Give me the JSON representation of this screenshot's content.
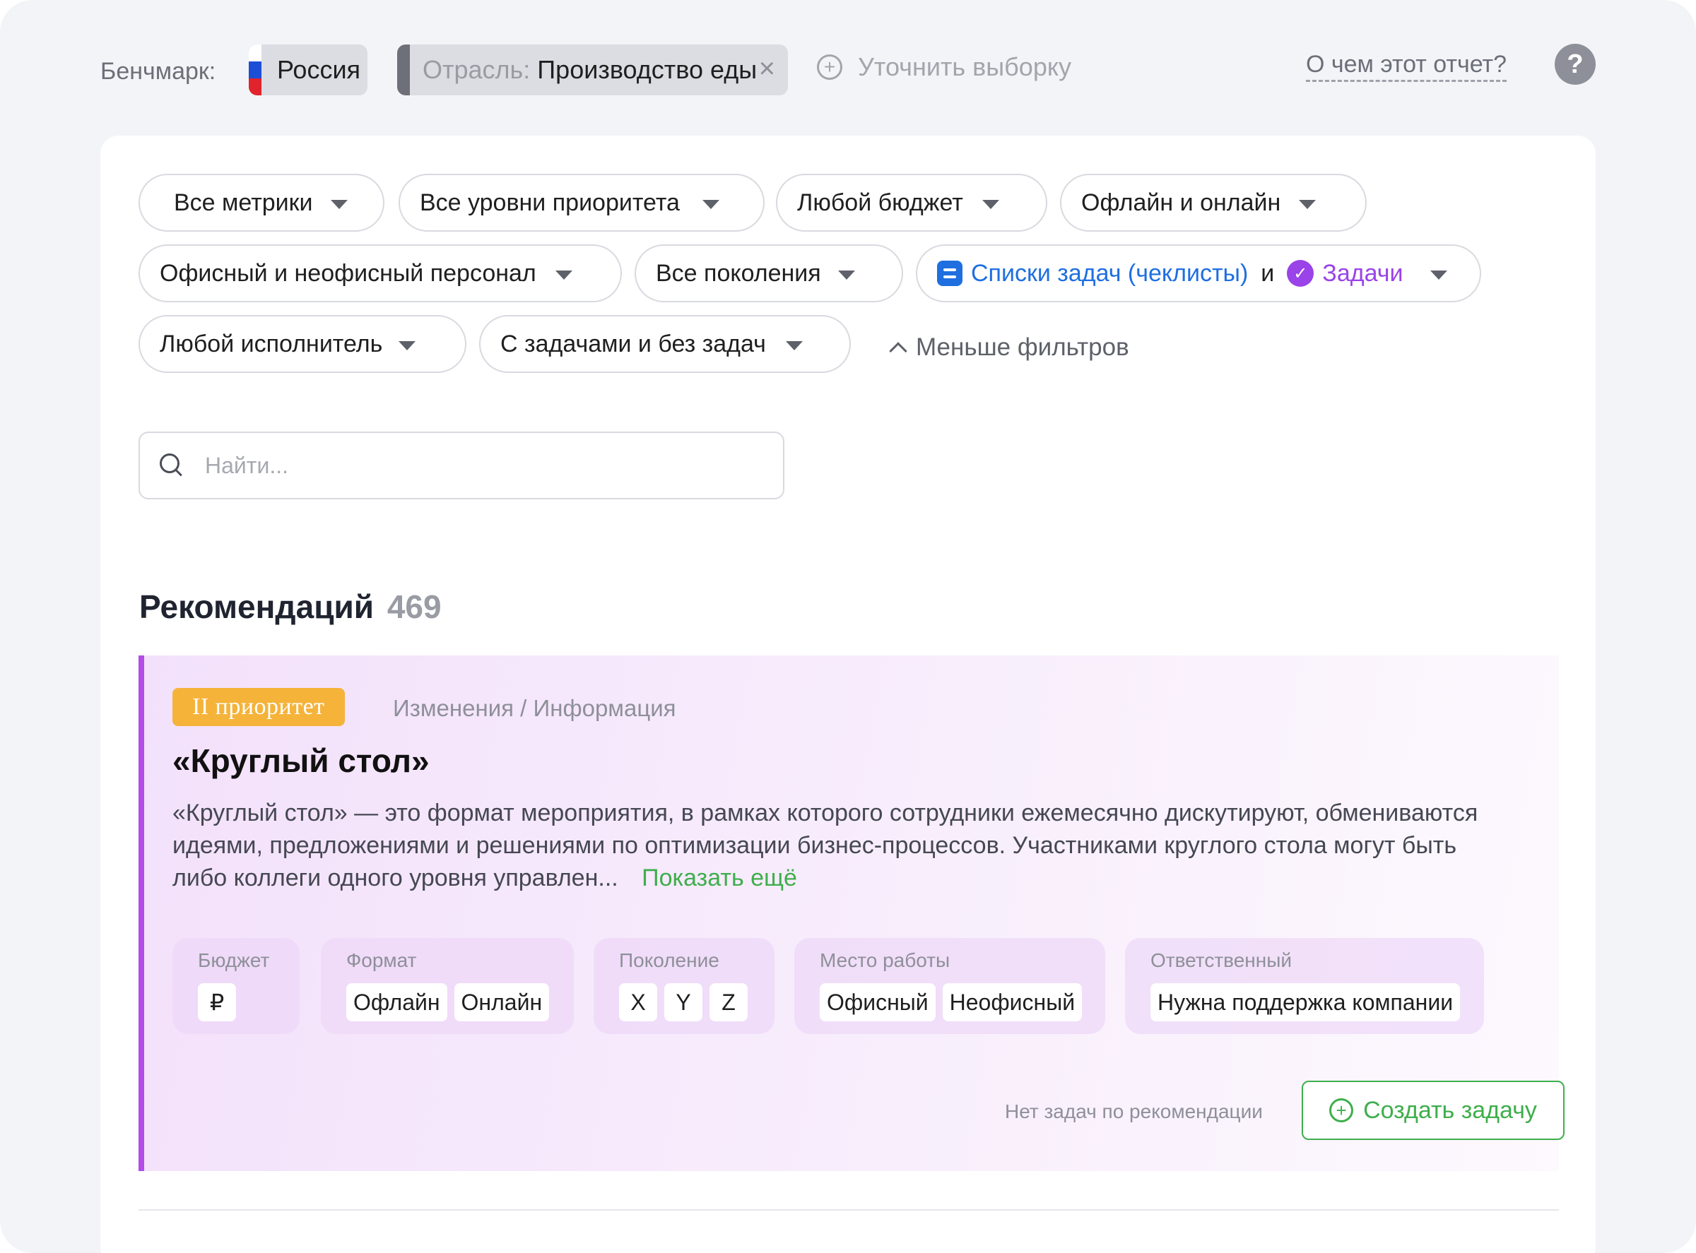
{
  "colors": {
    "background": "#f3f4f7",
    "accent_green": "#3fae4c",
    "accent_blue": "#1f6fe0",
    "accent_purple": "#9a43e8",
    "priority_badge": "#f5b33a",
    "card_border": "#b34ce8"
  },
  "header": {
    "benchmark_label": "Бенчмарк:",
    "country_chip": "Россия",
    "country_flag": [
      "#ffffff",
      "#1c4fd6",
      "#e0232c"
    ],
    "industry_prefix": "Отрасль:",
    "industry_value": "Производство еды",
    "industry_close_icon": "×",
    "refine_icon": "+",
    "refine_label": "Уточнить выборку",
    "about_link": "О чем этот отчет?",
    "help_icon": "?"
  },
  "filters": {
    "metrics": "Все метрики",
    "priority": "Все уровни приоритета",
    "budget": "Любой бюджет",
    "format": "Офлайн и онлайн",
    "staff": "Офисный и неофисный персонал",
    "generations": "Все поколения",
    "checklists": "Списки задач (чеклисты)",
    "and_word": "и",
    "tasks": "Задачи",
    "executor": "Любой исполнитель",
    "with_tasks": "С задачами и без задач",
    "fewer_filters": "Меньше фильтров"
  },
  "search": {
    "placeholder": "Найти..."
  },
  "recommendations": {
    "title": "Рекомендаций",
    "count": "469"
  },
  "card": {
    "priority": "II приоритет",
    "category": "Изменения / Информация",
    "title": "«Круглый стол»",
    "description": "«Круглый стол» — это формат мероприятия, в рамках которого сотрудники ежемесячно дискутируют, обмениваются идеями, предложениями и решениями по оптимизации бизнес-процессов. Участниками круглого стола могут быть либо коллеги одного уровня управлен...",
    "show_more": "Показать ещё",
    "attributes": {
      "budget": {
        "label": "Бюджет",
        "values": [
          "₽"
        ]
      },
      "format": {
        "label": "Формат",
        "values": [
          "Офлайн",
          "Онлайн"
        ]
      },
      "generation": {
        "label": "Поколение",
        "values": [
          "X",
          "Y",
          "Z"
        ]
      },
      "workplace": {
        "label": "Место работы",
        "values": [
          "Офисный",
          "Неофисный"
        ]
      },
      "responsible": {
        "label": "Ответственный",
        "values": [
          "Нужна поддержка компании"
        ]
      }
    },
    "no_tasks": "Нет задач по рекомендации",
    "create_task": "Создать задачу",
    "create_icon": "+"
  }
}
